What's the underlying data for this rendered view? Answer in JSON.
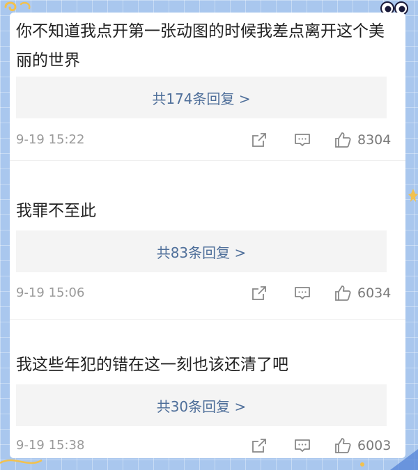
{
  "comments": [
    {
      "text": "你不知道我点开第一张动图的时候我差点离开这个美丽的世界",
      "reply_label": "共174条回复 >",
      "timestamp": "9-19 15:22",
      "likes": "8304"
    },
    {
      "text": "我罪不至此",
      "reply_label": "共83条回复 >",
      "timestamp": "9-19 15:06",
      "likes": "6034"
    },
    {
      "text": "我这些年犯的错在这一刻也该还清了吧",
      "reply_label": "共30条回复 >",
      "timestamp": "9-19 15:38",
      "likes": "6003"
    }
  ],
  "icons": {
    "share": "share-icon",
    "comment": "comment-icon",
    "like": "thumbs-up-icon"
  },
  "colors": {
    "background": "#a9c7ee",
    "card": "#ffffff",
    "reply_box": "#f4f4f4",
    "reply_link": "#4f6f9a",
    "meta_text": "#9a9a9a",
    "icon_stroke": "#888888"
  }
}
